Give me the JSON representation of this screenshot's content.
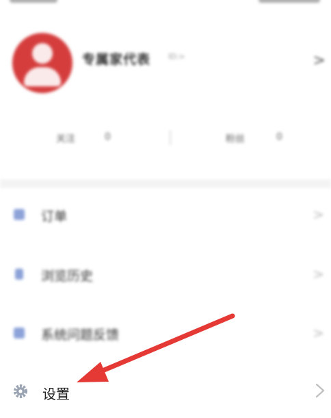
{
  "profile": {
    "name": "专属家代表",
    "tag": "ID:>"
  },
  "stats": [
    {
      "label": "关注",
      "value": "0"
    },
    {
      "label": "粉丝",
      "value": "0"
    }
  ],
  "menu": [
    {
      "label": "订单"
    },
    {
      "label": "浏览历史"
    },
    {
      "label": "系统问题反馈"
    }
  ],
  "settings": {
    "label": "设置"
  },
  "colors": {
    "avatar": "#d53d3d",
    "arrow": "#e53935",
    "menu_icon": "#8ca2d8"
  }
}
